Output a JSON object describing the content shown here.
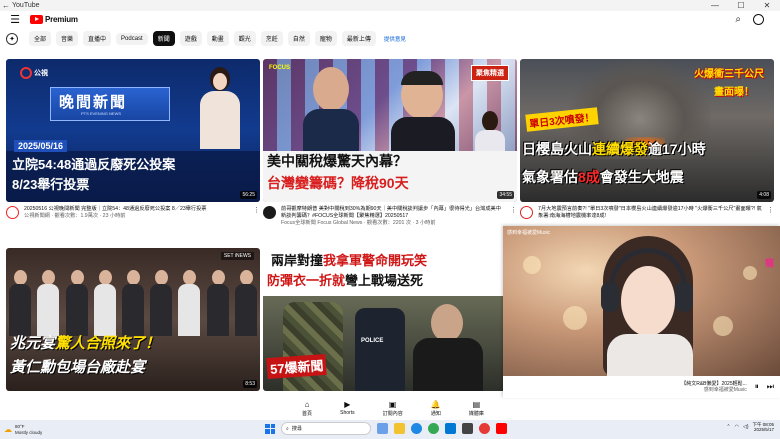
{
  "window": {
    "title": "YouTube",
    "back": "←",
    "minimize": "—",
    "maximize": "☐",
    "close": "✕"
  },
  "header": {
    "logo_text": "Premium",
    "menu_icon": "hamburger-icon",
    "search_icon": "search-icon"
  },
  "chips": {
    "items": [
      "全部",
      "音樂",
      "直播中",
      "Podcast",
      "新聞",
      "遊戲",
      "動畫",
      "觀光",
      "烹飪",
      "自然",
      "寵物",
      "最新上傳"
    ],
    "active_index": 4,
    "feedback": "提供意見"
  },
  "videos": [
    {
      "thumb": {
        "logo": "公視",
        "banner": "晚間新聞",
        "banner_sub": "PTS EVENING NEWS",
        "date": "2025/05/16",
        "caption1": "立院54:48通過反廢死公投案",
        "caption2": "8/23舉行投票"
      },
      "duration": "56:25",
      "title": "20250516 公視晚間新聞 完整版｜立院54：48通過反廢死公投案 8／23舉行投票",
      "subtitle": "公視新聞網 · 觀看次數：1.9萬次 · 23 小時前"
    },
    {
      "thumb": {
        "logo": "FOCUS",
        "badge": "聚焦精選",
        "caption1": "美中關稅爆驚天內幕？",
        "caption2": "台灣變籌碼？降稅90天"
      },
      "duration": "34:55",
      "title": "前哥觀摩特朗普 美對中關稅到30%為期90天｜美中關稅談判讓步「內幕」很待得光」台灣成美中新談判籌碼？#FOCUS全球新聞【聚焦精選】20250517",
      "subtitle": "Focus全球新聞 Focus Global News · 觀看次數：2201 次 · 3 小時前"
    },
    {
      "thumb": {
        "tag1": "單日3次噴發！",
        "tag2": "火爆衝三千公尺",
        "tag3": "畫面曝！",
        "caption1a": "日櫻島火山",
        "caption1b": "連續爆發",
        "caption1c": "逾17小時",
        "caption2a": "氣象署估",
        "caption2b": "8成",
        "caption2c": "會發生大地震"
      },
      "duration": "4:08",
      "title": "7月大地震預言前奏?! \"單日3次噴發\"日本櫻島火山連續爆發逾17小時 \"火爆衝三千公尺\"畫面曝?! 氣象署:南海海槽地震機率達8成!",
      "subtitle": ""
    },
    {
      "thumb": {
        "logo": "SET iNEWS",
        "caption1a": "兆元宴",
        "caption1b": "驚人合照來了！",
        "caption2": "黃仁勳包場台廠赴宴"
      },
      "duration": "8:53",
      "title": "",
      "subtitle": ""
    },
    {
      "thumb": {
        "caption1a": "兩岸對撞",
        "caption1b": "我拿軍警命開玩笑",
        "caption2a": "防彈衣一折就",
        "caption2b": "彎",
        "caption2c": "上戰場送死",
        "police": "POLICE",
        "logo": "57爆新聞"
      },
      "duration": "",
      "title": "",
      "subtitle": ""
    }
  ],
  "miniplayer": {
    "channel": "感到幸福被愛Music",
    "watermark": "寵",
    "title": "【純文R&B懶愛】2025輕鬆...",
    "subtitle": "感到幸福被愛Music",
    "pause": "⏸",
    "next": "⏭"
  },
  "bottom_nav": [
    {
      "label": "首頁",
      "icon": "⌂"
    },
    {
      "label": "Shorts",
      "icon": "▶"
    },
    {
      "label": "訂閱內容",
      "icon": "▣"
    },
    {
      "label": "通知",
      "icon": "🔔"
    },
    {
      "label": "媒體庫",
      "icon": "▤"
    }
  ],
  "taskbar": {
    "weather_temp": "80°F",
    "weather_desc": "Mostly cloudy",
    "search_placeholder": "搜尋",
    "time": "下午 08:05",
    "date": "2025/5/17"
  }
}
